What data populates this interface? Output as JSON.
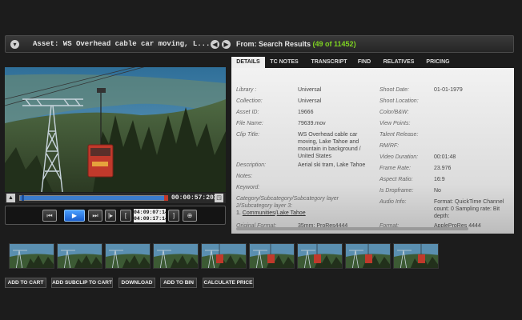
{
  "header": {
    "asset_title": "Asset: WS Overhead cable car moving, L...",
    "from_prefix": "From: Search Results ",
    "from_count": "(49 of 11452)"
  },
  "player": {
    "timecode": "00:00:57:203",
    "tc_in": "04:09:07:14",
    "tc_out": "04:09:17:14",
    "progress_fraction": 0.99
  },
  "tabs": [
    {
      "label": "DETAILS",
      "active": true
    },
    {
      "label": "TC NOTES"
    },
    {
      "label": "TRANSCRIPT"
    },
    {
      "label": "FIND"
    },
    {
      "label": "RELATIVES"
    },
    {
      "label": "PRICING"
    }
  ],
  "details": {
    "left": {
      "library": {
        "label": "Library :",
        "value": "Universal"
      },
      "collection": {
        "label": "Collection:",
        "value": "Universal"
      },
      "asset_id": {
        "label": "Asset ID:",
        "value": "19666"
      },
      "file_name": {
        "label": "File Name:",
        "value": "79639.mov"
      },
      "clip_title": {
        "label": "Clip Title:",
        "value_1": "WS Overhead cable car",
        "value_2": "moving, Lake Tahoe and",
        "value_3": "mountain in background /",
        "value_4": "United States"
      },
      "description": {
        "label": "Description:",
        "value": "Aerial ski tram, Lake Tahoe"
      },
      "notes": {
        "label": "Notes:"
      },
      "keyword": {
        "label": "Keyword:"
      },
      "category_1": "Category/Subcategory/Subcategory layer",
      "category_2": "2/Subcategory layer 3:",
      "category_value_prefix": "1. ",
      "category_link_1": "Communities",
      "category_sep": "/",
      "category_link_2": "Lake Tahoe",
      "original_format": {
        "label": "Original Format:",
        "value": "35mm; ProRes4444"
      }
    },
    "right": {
      "shoot_date": {
        "label": "Shoot Date:",
        "value": "01-01-1979"
      },
      "shoot_location": {
        "label": "Shoot Location:"
      },
      "color": {
        "label": "Color/B&W:"
      },
      "view_points": {
        "label": "View Points:"
      },
      "talent_release": {
        "label": "Talent Release:"
      },
      "rm_rf": {
        "label": "RM/RF:"
      },
      "video_duration": {
        "label": "Video Duration:",
        "value": "00:01:48"
      },
      "frame_rate": {
        "label": "Frame Rate:",
        "value": "23.976"
      },
      "aspect_ratio": {
        "label": "Aspect Ratio:",
        "value": "16:9"
      },
      "is_dropframe": {
        "label": "Is Dropframe:",
        "value": "No"
      },
      "audio_info": {
        "label": "Audio Info:",
        "value_1": "Format: QuickTime Channel",
        "value_2": "count: 0 Sampling rate: Bit",
        "value_3": "depth:"
      },
      "format": {
        "label": "Format:",
        "value": "AppleProRes 4444"
      }
    }
  },
  "actions": [
    {
      "label": "ADD TO CART"
    },
    {
      "label": "ADD SUBCLIP TO CART"
    },
    {
      "label": "DOWNLOAD"
    },
    {
      "label": "ADD TO BIN"
    },
    {
      "label": "CALCULATE PRICE"
    }
  ],
  "icons": {
    "collapse": "chevron-down-icon",
    "prev": "arrow-left-icon",
    "next": "arrow-right-icon",
    "rewind": "rewind-icon",
    "play": "play-icon",
    "fast_forward": "fast-forward-icon",
    "step": "step-forward-icon",
    "mark_in": "mark-in-icon",
    "mark_out": "mark-out-icon",
    "zoom": "zoom-icon"
  },
  "colors": {
    "accent_green": "#7ed321",
    "play_blue": "#2a7be8",
    "cable_car_red": "#c0392b"
  }
}
